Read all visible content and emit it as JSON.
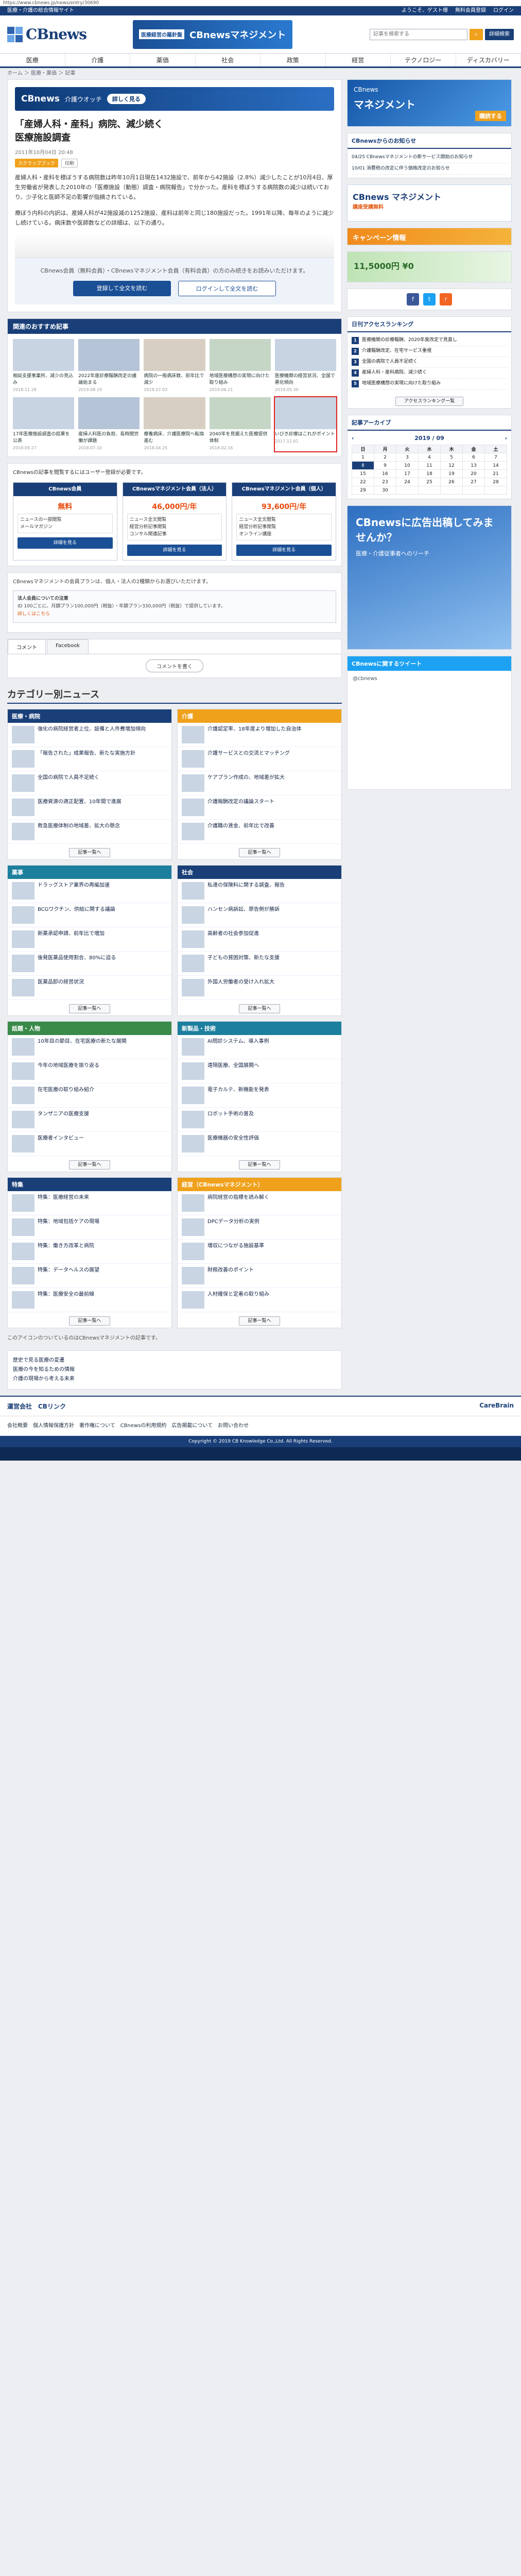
{
  "url": "https://www.cbnews.jp/news/entry/30690",
  "strip": {
    "left": "医療・介護の総合情報サイト",
    "user": "ようこそ、ゲスト様",
    "links": [
      "無料会員登録",
      "ログイン"
    ]
  },
  "logo": "CBnews",
  "mgmt_banner": {
    "tag": "医療経営の羅針盤",
    "name": "CBnewsマネジメント"
  },
  "search": {
    "placeholder": "記事を検索する",
    "detail": "詳細検索"
  },
  "nav": [
    "医療",
    "介護",
    "薬価",
    "社会",
    "政策",
    "経営",
    "テクノロジー",
    "ディスカバリー"
  ],
  "crumb": "ホーム ＞ 医療・薬価 ＞ 記事",
  "ad_top": {
    "brand": "CBnews",
    "label": "介護ウオッチ",
    "pill": "詳しく見る"
  },
  "article": {
    "title": "「産婦人科・産科」病院、減少続く\n医療施設調査",
    "date": "2011年10月04日 20:48",
    "tags": [
      "スクラップブック",
      "印刷"
    ],
    "p1": "産婦人科・産科を標ぼうする病院数は昨年10月1日現在1432施設で、前年から42施設（2.8%）減少したことが10月4日、厚生労働省が発表した2010年の「医療施設（動態）調査・病院報告」で分かった。産科を標ぼうする病院数の減少は続いており、少子化と医師不足の影響が指摘されている。",
    "p2": "療ぼう内科の内訳は、産婦人科が42施設減の1252施設、産科は前年と同じ180施設だった。1991年以降、毎年のように減少し続けている。病床数や医師数などの詳細は、以下の通り。",
    "login_text": "CBnews会員（無料会員）・CBnewsマネジメント会員（有料会員）の方のみ続きをお読みいただけます。",
    "btn_register": "登録して全文を読む",
    "btn_login": "ログインして全文を読む"
  },
  "rec": {
    "head": "関連のおすすめ記事",
    "items": [
      {
        "t": "相談支援事業所、減少の見込み",
        "d": "2018.11.28"
      },
      {
        "t": "2022年度診療報酬改定の議論始まる",
        "d": "2019.08.19"
      },
      {
        "t": "病院の一般病床数、前年比で減少",
        "d": "2019.07.03"
      },
      {
        "t": "地域医療構想の実現に向けた取り組み",
        "d": "2019.06.21"
      },
      {
        "t": "医療機関の経営状況、全国で悪化傾向",
        "d": "2019.05.30"
      },
      {
        "t": "17年医療施設調査の結果を公表",
        "d": "2018.09.27"
      },
      {
        "t": "産婦人科医の負担、長時間労働が課題",
        "d": "2018.07.10"
      },
      {
        "t": "療養病床、介護医療院へ転換進む",
        "d": "2018.04.25"
      },
      {
        "t": "2040年を見据えた医療提供体制",
        "d": "2018.02.16"
      },
      {
        "t": "いびき診療はこれがポイント",
        "d": "2017.12.01"
      }
    ]
  },
  "pay": {
    "lead": "CBnewsの記事を閲覧するにはユーザー登録が必要です。",
    "plans": [
      {
        "name": "CBnews会員",
        "price": "無料",
        "features": [
          "ニュースの一部閲覧",
          "メールマガジン"
        ],
        "btn": "詳細を見る"
      },
      {
        "name": "CBnewsマネジメント会員（法人）",
        "price": "46,000円/年",
        "features": [
          "ニュース全文閲覧",
          "経営分析記事閲覧",
          "コンサル関連記事"
        ],
        "btn": "詳細を見る"
      },
      {
        "name": "CBnewsマネジメント会員（個人）",
        "price": "93,600円/年",
        "features": [
          "ニュース全文閲覧",
          "経営分析記事閲覧",
          "オンライン講座"
        ],
        "btn": "詳細を見る"
      }
    ],
    "note": "CBnewsマネジメントの会員プランは、個人・法人の2種類からお選びいただけます。",
    "group_title": "法人会員についての注意",
    "group_text": "ID 100ごとに、月額プラン100,000円（税抜）・年額プラン330,000円（税抜）で提供しています。",
    "group_link": "詳しくはこちら"
  },
  "tabs": [
    "コメント",
    "Facebook"
  ],
  "comment_btn": "コメントを書く",
  "categories": {
    "title": "カテゴリー別ニュース",
    "blocks": [
      {
        "name": "医療・病院",
        "cls": "",
        "items": [
          "強化の病院経営者上位、設備と人件費増加傾向",
          "「報告された」成果報告、新たな実施方針",
          "全国の病院で人員不足続く",
          "医療資源の適正配置、10年間で進展",
          "救急医療体制の地域差、拡大の懸念"
        ]
      },
      {
        "name": "介護",
        "cls": "orange",
        "items": [
          "介護認定率、18年度より増加した自治体",
          "介護サービスとの交流とマッチング",
          "ケアプラン作成の、地域差が拡大",
          "介護報酬改定の議論スタート",
          "介護職の賃金、前年比で改善"
        ]
      },
      {
        "name": "薬事",
        "cls": "teal",
        "items": [
          "ドラッグストア業界の再編加速",
          "BCGワクチン、供給に関する議論",
          "新薬承認申請、前年比で増加",
          "後発医薬品使用割合、80%に迫る",
          "医薬品卸の経営状況"
        ]
      },
      {
        "name": "社会",
        "cls": "",
        "items": [
          "私達の保険料に関する調査、報告",
          "ハンセン病訴訟、原告側が勝訴",
          "高齢者の社会参加促進",
          "子どもの貧困対策、新たな支援",
          "外国人労働者の受け入れ拡大"
        ]
      },
      {
        "name": "話題・人物",
        "cls": "green",
        "items": [
          "10年目の節目、在宅医療の新たな展開",
          "今年の地域医療を振り返る",
          "在宅医療の取り組み紹介",
          "タンザニアの医療支援",
          "医療者インタビュー"
        ]
      },
      {
        "name": "新製品・技術",
        "cls": "teal",
        "items": [
          "AI問診システム、導入事例",
          "遠隔医療、全国展開へ",
          "電子カルテ、新機能を発表",
          "ロボット手術の普及",
          "医療機器の安全性評価"
        ]
      },
      {
        "name": "特集",
        "cls": "",
        "items": [
          "特集：医療経営の未来",
          "特集：地域包括ケアの現場",
          "特集：働き方改革と病院",
          "特集：データヘルスの展望",
          "特集：医療安全の最前線"
        ]
      },
      {
        "name": "経営（CBnewsマネジメント）",
        "cls": "orange",
        "items": [
          "病院経営の指標を読み解く",
          "DPCデータ分析の実例",
          "増収につながる施設基準",
          "財務改善のポイント",
          "人材確保と定着の取り組み"
        ]
      }
    ],
    "more": "記事一覧へ",
    "footnote": "このアイコンのついているのはCBnewsマネジメントの記事です。"
  },
  "bottom_links": [
    "歴史で見る医療の変遷",
    "医療の今を知るための情報",
    "介護の現場から考える未来"
  ],
  "side": {
    "ad1": {
      "tag": "CBnews",
      "name": "マネジメント",
      "buy": "購読する"
    },
    "news_head": "CBnewsからのお知らせ",
    "news": [
      "04/25 CBnewsマネジメントの新サービス開始のお知らせ",
      "10/01 消費税の改定に伴う価格改定のお知らせ"
    ],
    "ad2": {
      "title": "CBnews",
      "sub": "マネジメント",
      "promo": "講座受講無料"
    },
    "orange": "キャンペーン情報",
    "green": "11,5000円 ¥0",
    "rank_head": "日刊アクセスランキング",
    "rank": [
      "医療機関の診療報酬、2020年度改定で見直し",
      "介護報酬改定、在宅サービス重視",
      "全国の病院で人員不足続く",
      "産婦人科・産科病院、減少続く",
      "地域医療構想の実現に向けた取り組み"
    ],
    "rank_more": "アクセスランキング一覧",
    "cal_head": "記事アーカイブ",
    "cal_month": "2019 / 09",
    "days": [
      "日",
      "月",
      "火",
      "水",
      "木",
      "金",
      "土"
    ],
    "weeks": [
      [
        "1",
        "2",
        "3",
        "4",
        "5",
        "6",
        "7"
      ],
      [
        "8",
        "9",
        "10",
        "11",
        "12",
        "13",
        "14"
      ],
      [
        "15",
        "16",
        "17",
        "18",
        "19",
        "20",
        "21"
      ],
      [
        "22",
        "23",
        "24",
        "25",
        "26",
        "27",
        "28"
      ],
      [
        "29",
        "30",
        "",
        "",
        "",
        "",
        ""
      ]
    ],
    "big_ad": {
      "title": "CBnewsに広告出稿してみませんか？",
      "sub": "医療・介護従事者へのリーチ"
    },
    "tw_head": "CBnewsに関するツイート",
    "tw_body": "@cbnews"
  },
  "footer": {
    "company": "運営会社　CBリンク",
    "logo": "CareBrain",
    "links": "会社概要　個人情報保護方針　著作権について　CBnewsの利用規約　広告掲載について　お問い合わせ",
    "copy": "Copyright © 2019 CB Knowledge Co.,Ltd. All Rights Reserved."
  }
}
